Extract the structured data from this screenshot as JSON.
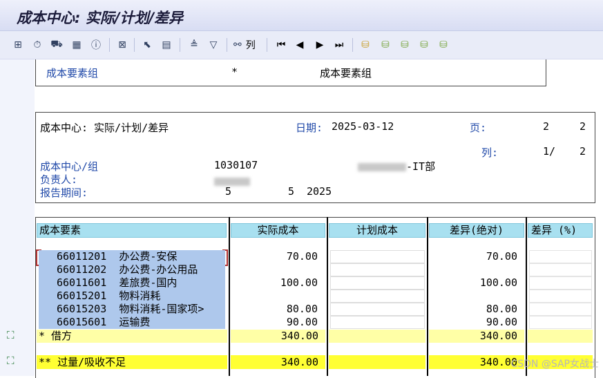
{
  "window_title": "成本中心: 实际/计划/差异",
  "toolbar": {
    "column_label": "列",
    "icons": [
      "hierarchy-icon",
      "stopwatch-icon",
      "cart-icon",
      "grid-icon",
      "info-icon",
      "excel-export-icon",
      "select-icon",
      "layout-icon",
      "sort-asc-icon",
      "filter-icon",
      "binoculars-icon",
      "first-page-icon",
      "prev-page-icon",
      "next-page-icon",
      "last-page-icon",
      "node-icon-1",
      "node-icon-2",
      "node-icon-3",
      "node-icon-4",
      "node-icon-5"
    ]
  },
  "top_box": {
    "label": "成本要素组",
    "star": "*",
    "value": "成本要素组"
  },
  "report_header": {
    "title": "成本中心: 实际/计划/差异",
    "date_label": "日期:",
    "date_value": "2025-03-12",
    "page_label": "页:",
    "page_current": "2",
    "page_total": "2",
    "col_label": "列:",
    "col_value": "1/",
    "col_total": "2",
    "cost_center_label": "成本中心/组",
    "cost_center_value": "1030107",
    "cost_center_desc": "-IT部",
    "responsible_label": "负责人:",
    "period_label": "报告期间:",
    "period_from": "5",
    "period_to": "5",
    "period_year": "2025"
  },
  "table": {
    "headers": [
      "成本要素",
      "实际成本",
      "计划成本",
      "差异(绝对)",
      "差异 (%)"
    ],
    "rows": [
      {
        "code": "66011201",
        "name": "办公费-安保",
        "actual": "70.00",
        "plan": "",
        "diff": "70.00",
        "pct": ""
      },
      {
        "code": "66011202",
        "name": "办公费-办公用品",
        "actual": "",
        "plan": "",
        "diff": "",
        "pct": ""
      },
      {
        "code": "66011601",
        "name": "差旅费-国内",
        "actual": "100.00",
        "plan": "",
        "diff": "100.00",
        "pct": ""
      },
      {
        "code": "66015201",
        "name": "物料消耗",
        "actual": "",
        "plan": "",
        "diff": "",
        "pct": ""
      },
      {
        "code": "66015203",
        "name": "物料消耗-国家项>",
        "actual": "80.00",
        "plan": "",
        "diff": "80.00",
        "pct": ""
      },
      {
        "code": "66015601",
        "name": "运输费",
        "actual": "90.00",
        "plan": "",
        "diff": "90.00",
        "pct": ""
      }
    ],
    "subtotal": {
      "label": "*  借方",
      "actual": "340.00",
      "diff": "340.00"
    },
    "total": {
      "label": "** 过量/吸收不足",
      "actual": "340.00",
      "diff": "340.00"
    }
  },
  "watermark": "CSDN @SAP女战士",
  "colors": {
    "header_cyan": "#a8e0f0",
    "row_blue": "#aec8ec",
    "subtotal_yellow": "#ffffa6",
    "total_yellow": "#ffff33"
  }
}
